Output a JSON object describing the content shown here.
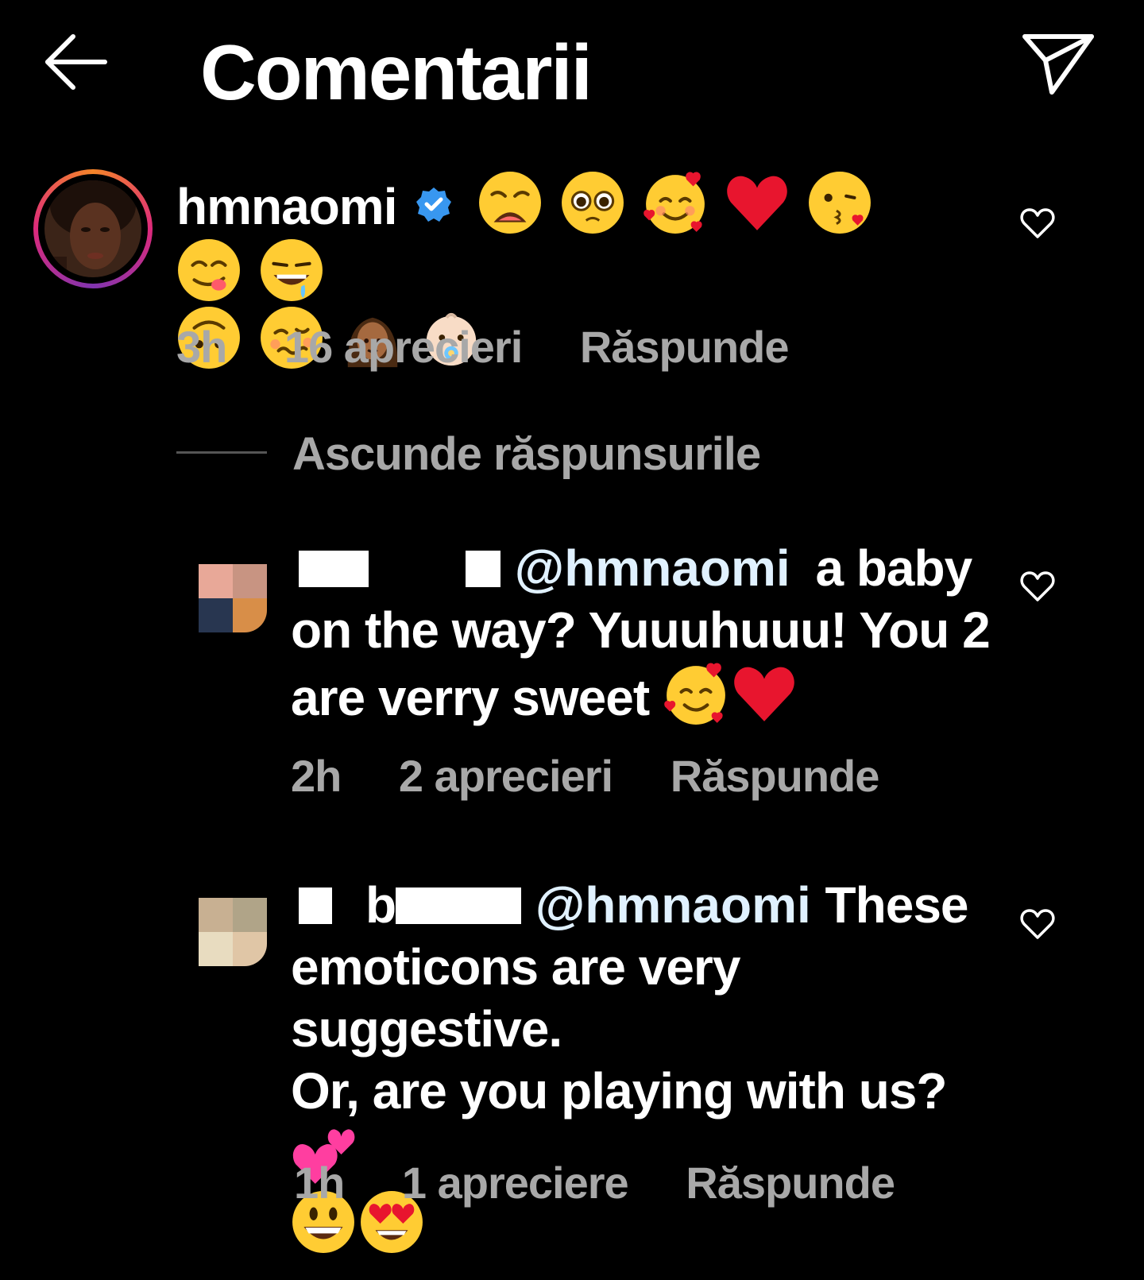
{
  "header": {
    "title": "Comentarii",
    "back_icon": "arrow-left-icon",
    "share_icon": "paper-plane-icon"
  },
  "main_comment": {
    "username": "hmnaomi",
    "verified": true,
    "emojis_line1": [
      "weary-face",
      "pleading-face",
      "smiling-face-with-hearts",
      "red-heart",
      "face-blowing-kiss",
      "face-savoring-food",
      "drooling-face"
    ],
    "emojis_line2": [
      "upside-down-face",
      "woozy-face",
      "woman-medium-dark-skin",
      "baby-with-pacifier"
    ],
    "time": "3h",
    "likes": "16 aprecieri",
    "reply_label": "Răspunde"
  },
  "hide_replies_label": "Ascunde răspunsurile",
  "replies": [
    {
      "mention": "@hmnaomi",
      "text_line1": "a baby",
      "text_line2": "on the way? Yuuuhuuu! You 2",
      "text_line3": "are verry sweet",
      "emojis": [
        "smiling-face-with-hearts",
        "red-heart"
      ],
      "time": "2h",
      "likes": "2 aprecieri",
      "reply_label": "Răspunde"
    },
    {
      "username_partial": "b",
      "mention": "@hmnaomi",
      "text_line1": "These",
      "text_line2": "emoticons are very suggestive.",
      "text_line3": "Or, are you playing with us?",
      "emojis": [
        "two-hearts",
        "grinning-face",
        "smiling-face-with-heart-eyes"
      ],
      "time": "1h",
      "likes": "1 apreciere",
      "reply_label": "Răspunde"
    }
  ],
  "colors": {
    "background": "#000000",
    "text": "#ffffff",
    "meta": "#a8a8a8",
    "mention": "#e0f1ff",
    "verified": "#3897f0"
  }
}
